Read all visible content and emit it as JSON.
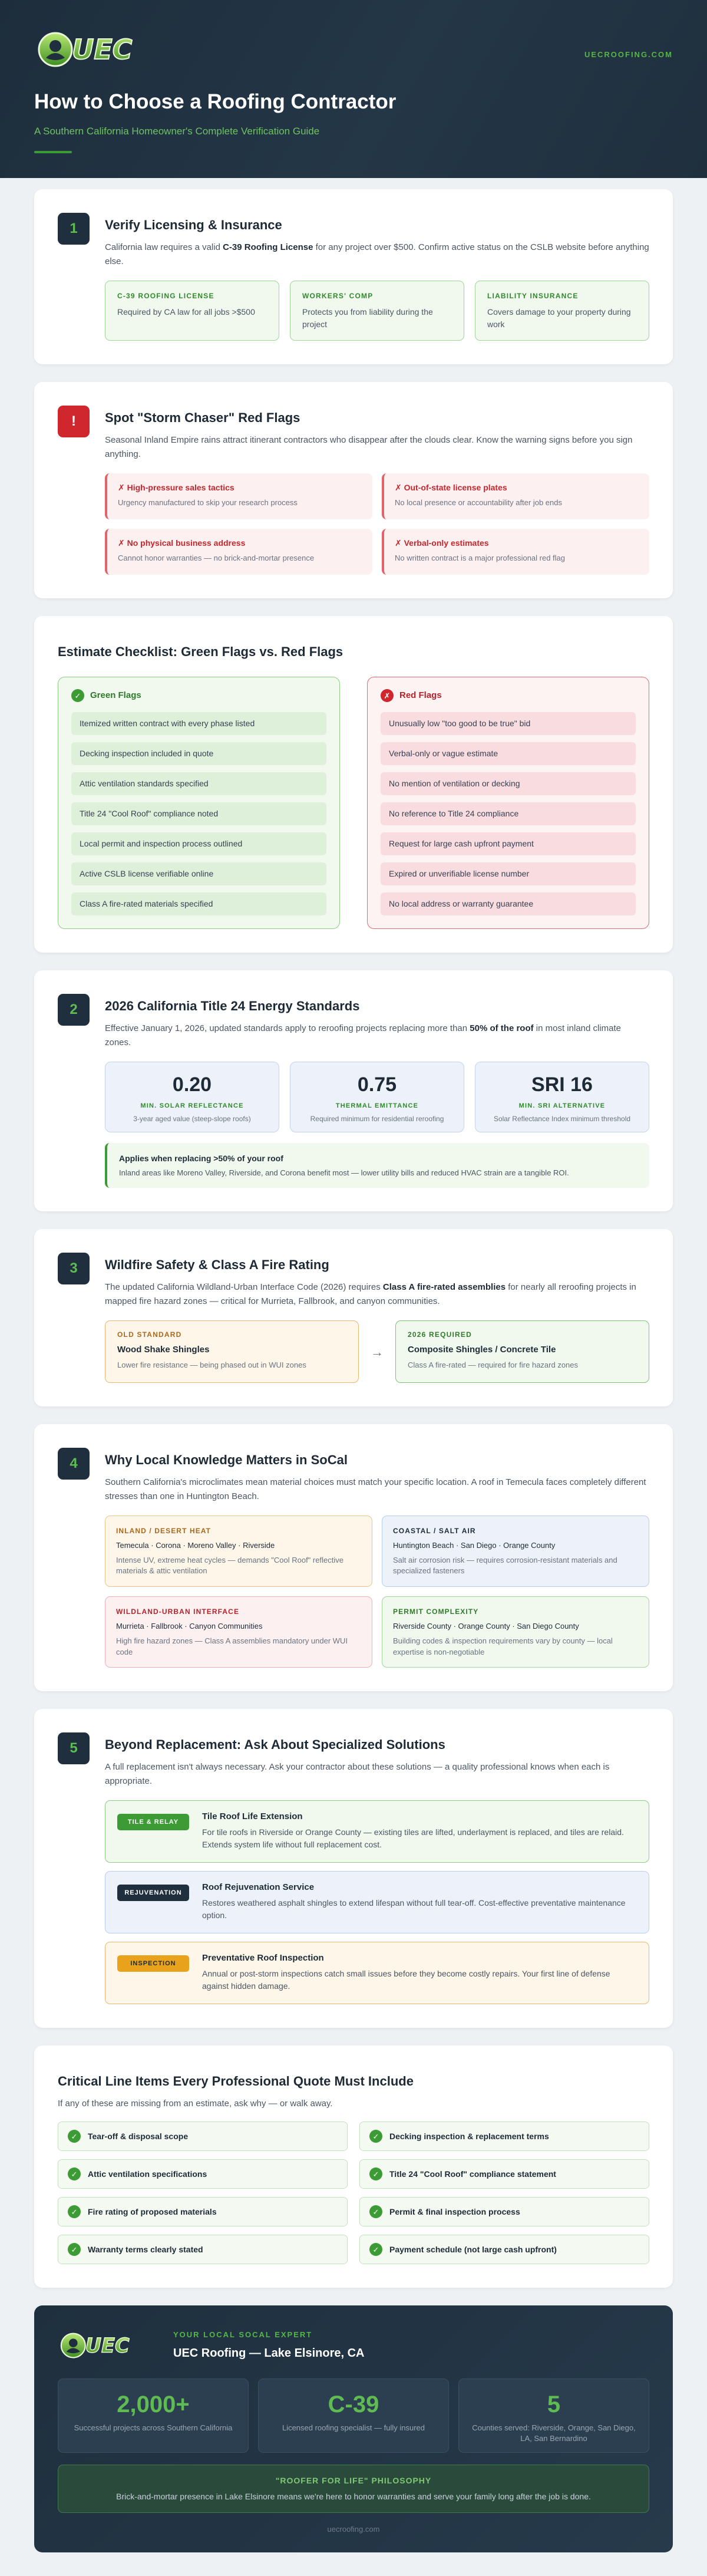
{
  "brand": {
    "logo_text": "UEC",
    "url_upper": "UECROOFING.COM",
    "url_lower": "uecroofing.com",
    "colors": {
      "navy": "#1f2f3e",
      "green": "#3d9b36",
      "red": "#d0262e",
      "amber": "#e9a21c"
    }
  },
  "hero": {
    "title": "How to Choose a Roofing Contractor",
    "subtitle": "A Southern California Homeowner's Complete Verification Guide"
  },
  "s1": {
    "number": "1",
    "title": "Verify Licensing & Insurance",
    "desc_pre": "California law requires a valid ",
    "desc_bold": "C-39 Roofing License",
    "desc_post": " for any project over $500. Confirm active status on the CSLB website before anything else.",
    "boxes": [
      {
        "label": "C-39 ROOFING LICENSE",
        "text": "Required by CA law for all jobs >$500"
      },
      {
        "label": "WORKERS' COMP",
        "text": "Protects you from liability during the project"
      },
      {
        "label": "LIABILITY INSURANCE",
        "text": "Covers damage to your property during work"
      }
    ]
  },
  "s2": {
    "number": "!",
    "title": "Spot \"Storm Chaser\" Red Flags",
    "desc": "Seasonal Inland Empire rains attract itinerant contractors who disappear after the clouds clear. Know the warning signs before you sign anything.",
    "flags": [
      {
        "title": "✗ High-pressure sales tactics",
        "text": "Urgency manufactured to skip your research process"
      },
      {
        "title": "✗ Out-of-state license plates",
        "text": "No local presence or accountability after job ends"
      },
      {
        "title": "✗ No physical business address",
        "text": "Cannot honor warranties — no brick-and-mortar presence"
      },
      {
        "title": "✗ Verbal-only estimates",
        "text": "No written contract is a major professional red flag"
      }
    ]
  },
  "s3": {
    "title": "Estimate Checklist: Green Flags vs. Red Flags",
    "green_title": "Green Flags",
    "green_icon": "✓",
    "red_title": "Red Flags",
    "red_icon": "✗",
    "green": [
      "Itemized written contract with every phase listed",
      "Decking inspection included in quote",
      "Attic ventilation standards specified",
      "Title 24 \"Cool Roof\" compliance noted",
      "Local permit and inspection process outlined",
      "Active CSLB license verifiable online",
      "Class A fire-rated materials specified"
    ],
    "red": [
      "Unusually low \"too good to be true\" bid",
      "Verbal-only or vague estimate",
      "No mention of ventilation or decking",
      "No reference to Title 24 compliance",
      "Request for large cash upfront payment",
      "Expired or unverifiable license number",
      "No local address or warranty guarantee"
    ]
  },
  "s4": {
    "number": "2",
    "title": "2026 California Title 24 Energy Standards",
    "desc_pre": "Effective January 1, 2026, updated standards apply to reroofing projects replacing more than ",
    "desc_bold": "50% of the roof",
    "desc_post": " in most inland climate zones.",
    "stats": [
      {
        "value": "0.20",
        "label": "MIN. SOLAR REFLECTANCE",
        "sub": "3-year aged value (steep-slope roofs)"
      },
      {
        "value": "0.75",
        "label": "THERMAL EMITTANCE",
        "sub": "Required minimum for residential reroofing"
      },
      {
        "value": "SRI 16",
        "label": "MIN. SRI ALTERNATIVE",
        "sub": "Solar Reflectance Index minimum threshold"
      }
    ],
    "note_title": "Applies when replacing >50% of your roof",
    "note_text": "Inland areas like Moreno Valley, Riverside, and Corona benefit most — lower utility bills and reduced HVAC strain are a tangible ROI."
  },
  "s5": {
    "number": "3",
    "title": "Wildfire Safety & Class A Fire Rating",
    "desc_pre": "The updated California Wildland-Urban Interface Code (2026) requires ",
    "desc_bold": "Class A fire-rated assemblies",
    "desc_post": " for nearly all reroofing projects in mapped fire hazard zones — critical for Murrieta, Fallbrook, and canyon communities.",
    "old_label": "OLD STANDARD",
    "old_title": "Wood Shake Shingles",
    "old_text": "Lower fire resistance — being phased out in WUI zones",
    "arrow": "→",
    "new_label": "2026 REQUIRED",
    "new_title": "Composite Shingles / Concrete Tile",
    "new_text": "Class A fire-rated — required for fire hazard zones"
  },
  "s6": {
    "number": "4",
    "title": "Why Local Knowledge Matters in SoCal",
    "desc": "Southern California's microclimates mean material choices must match your specific location. A roof in Temecula faces completely different stresses than one in Huntington Beach.",
    "regions": [
      {
        "label": "INLAND / DESERT HEAT",
        "cities": "Temecula · Corona · Moreno Valley · Riverside",
        "text": "Intense UV, extreme heat cycles — demands \"Cool Roof\" reflective materials & attic ventilation"
      },
      {
        "label": "COASTAL / SALT AIR",
        "cities": "Huntington Beach · San Diego · Orange County",
        "text": "Salt air corrosion risk — requires corrosion-resistant materials and specialized fasteners"
      },
      {
        "label": "WILDLAND-URBAN INTERFACE",
        "cities": "Murrieta · Fallbrook · Canyon Communities",
        "text": "High fire hazard zones — Class A assemblies mandatory under WUI code"
      },
      {
        "label": "PERMIT COMPLEXITY",
        "cities": "Riverside County · Orange County · San Diego County",
        "text": "Building codes & inspection requirements vary by county — local expertise is non-negotiable"
      }
    ]
  },
  "s7": {
    "number": "5",
    "title": "Beyond Replacement: Ask About Specialized Solutions",
    "desc": "A full replacement isn't always necessary. Ask your contractor about these solutions — a quality professional knows when each is appropriate.",
    "services": [
      {
        "tag": "TILE & RELAY",
        "title": "Tile Roof Life Extension",
        "text": "For tile roofs in Riverside or Orange County — existing tiles are lifted, underlayment is replaced, and tiles are relaid. Extends system life without full replacement cost."
      },
      {
        "tag": "REJUVENATION",
        "title": "Roof Rejuvenation Service",
        "text": "Restores weathered asphalt shingles to extend lifespan without full tear-off. Cost-effective preventative maintenance option."
      },
      {
        "tag": "INSPECTION",
        "title": "Preventative Roof Inspection",
        "text": "Annual or post-storm inspections catch small issues before they become costly repairs. Your first line of defense against hidden damage."
      }
    ]
  },
  "s8": {
    "title": "Critical Line Items Every Professional Quote Must Include",
    "desc": "If any of these are missing from an estimate, ask why — or walk away.",
    "icon": "✓",
    "items": [
      "Tear-off & disposal scope",
      "Decking inspection & replacement terms",
      "Attic ventilation specifications",
      "Title 24 \"Cool Roof\" compliance statement",
      "Fire rating of proposed materials",
      "Permit & final inspection process",
      "Warranty terms clearly stated",
      "Payment schedule (not large cash upfront)"
    ]
  },
  "footer": {
    "eyebrow": "YOUR LOCAL SOCAL EXPERT",
    "company": "UEC Roofing — Lake Elsinore, CA",
    "stats": [
      {
        "value": "2,000+",
        "text": "Successful projects across Southern California"
      },
      {
        "value": "C-39",
        "text": "Licensed roofing specialist — fully insured"
      },
      {
        "value": "5",
        "text": "Counties served: Riverside, Orange, San Diego, LA, San Bernardino"
      }
    ],
    "philosophy_title": "\"ROOFER FOR LIFE\" PHILOSOPHY",
    "philosophy_text": "Brick-and-mortar presence in Lake Elsinore means we're here to honor warranties and serve your family long after the job is done."
  }
}
